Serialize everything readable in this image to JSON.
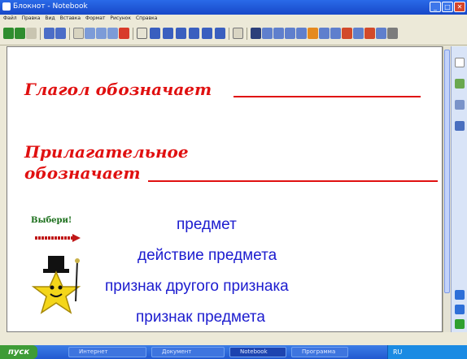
{
  "window": {
    "title": "Блокнот - Notebook",
    "buttons": [
      "_",
      "□",
      "✕"
    ]
  },
  "menu": [
    "Файл",
    "Правка",
    "Вид",
    "Вставка",
    "Формат",
    "Рисунок",
    "Справка"
  ],
  "slide": {
    "heading1": "Глагол обозначает",
    "heading2_line1": "Прилагательное",
    "heading2_line2": "обозначает",
    "choose_label": "Выбери!",
    "options": [
      "предмет",
      "действие предмета",
      "признак другого признака",
      "признак предмета"
    ]
  },
  "taskbar": {
    "start_label": "пуск",
    "tasks": [
      "Интернет",
      "Документ",
      "Notebook",
      "Программа"
    ],
    "tray_text": "RU"
  },
  "colors": {
    "heading": "#e01010",
    "options": "#1c1ccf",
    "choose": "#1a6e1a",
    "titlebar": "#1748c8"
  }
}
